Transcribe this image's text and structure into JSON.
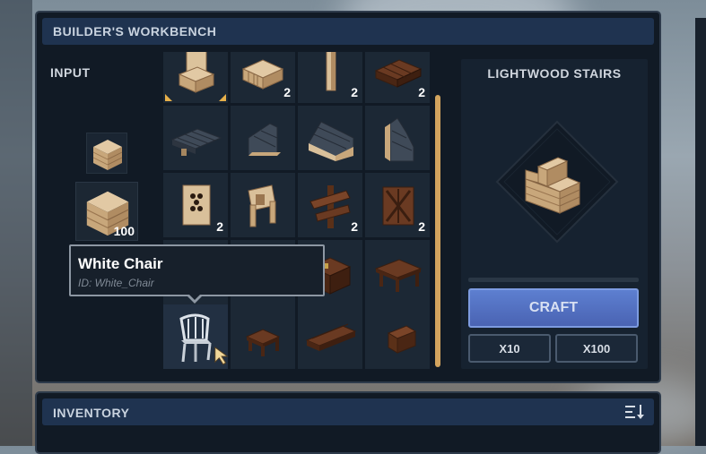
{
  "workbench": {
    "title": "BUILDER'S WORKBENCH"
  },
  "input": {
    "label": "INPUT",
    "slot_small": {
      "item": "lightwood-block",
      "count": ""
    },
    "slot_big": {
      "item": "lightwood-block",
      "count": "100"
    }
  },
  "grid": {
    "rows": [
      [
        {
          "item": "lightwood-chair",
          "count": "",
          "selected": true
        },
        {
          "item": "lightwood-plank",
          "count": "2"
        },
        {
          "item": "lightwood-post",
          "count": "2"
        },
        {
          "item": "dark-pallet",
          "count": "2"
        }
      ],
      [
        {
          "item": "dark-shingle-roof",
          "count": ""
        },
        {
          "item": "dark-roof-stairs",
          "count": ""
        },
        {
          "item": "lightwood-shingle-slope",
          "count": ""
        },
        {
          "item": "stone-roof-stairs",
          "count": ""
        }
      ],
      [
        {
          "item": "lightwood-lattice",
          "count": "2"
        },
        {
          "item": "lightwood-signpost",
          "count": ""
        },
        {
          "item": "dark-sign",
          "count": "2"
        },
        {
          "item": "dark-lattice",
          "count": "2"
        }
      ],
      [
        {
          "item": "hidden",
          "count": ""
        },
        {
          "item": "hidden",
          "count": ""
        },
        {
          "item": "dark-crate",
          "count": ""
        },
        {
          "item": "dark-table",
          "count": ""
        }
      ],
      [
        {
          "item": "white-chair",
          "count": "",
          "hovered": true
        },
        {
          "item": "small-dark-table",
          "count": ""
        },
        {
          "item": "dark-bench",
          "count": ""
        },
        {
          "item": "dark-stool",
          "count": ""
        }
      ]
    ]
  },
  "tooltip": {
    "name": "White Chair",
    "id": "ID: White_Chair"
  },
  "recipe": {
    "title": "LIGHTWOOD STAIRS",
    "progress": 0
  },
  "buttons": {
    "craft": "CRAFT",
    "x10": "X10",
    "x100": "X100"
  },
  "inventory": {
    "title": "INVENTORY"
  },
  "colors": {
    "accent": "#d3a45e",
    "craft": "#5470c4",
    "panel": "#111a25",
    "header": "#1f3350"
  }
}
